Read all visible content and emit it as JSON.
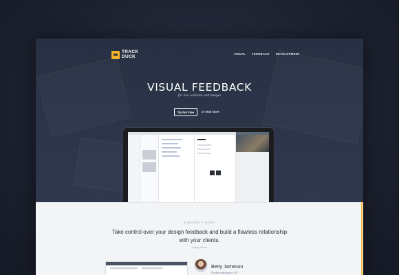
{
  "brand": {
    "line1": "TRACK",
    "line2": "DUCK",
    "accent": "#f2b22b"
  },
  "nav": [
    {
      "label": "VISUAL"
    },
    {
      "label": "FEEDBACK"
    },
    {
      "label": "DEVELOPMENT"
    }
  ],
  "hero": {
    "title": "VISUAL FEEDBACK",
    "subtitle": "for live websites and images",
    "cta_button": "Try For Free",
    "cta_link": "or read more"
  },
  "section": {
    "eyebrow": "HOW DOES IT WORK?",
    "tagline": "Take control over your design feedback and build a flawless relationship with your clients.",
    "tagline_sub": "Happy clients"
  },
  "testimonial": {
    "name": "Betty Jameson",
    "title": "Fashion designer, NY"
  }
}
